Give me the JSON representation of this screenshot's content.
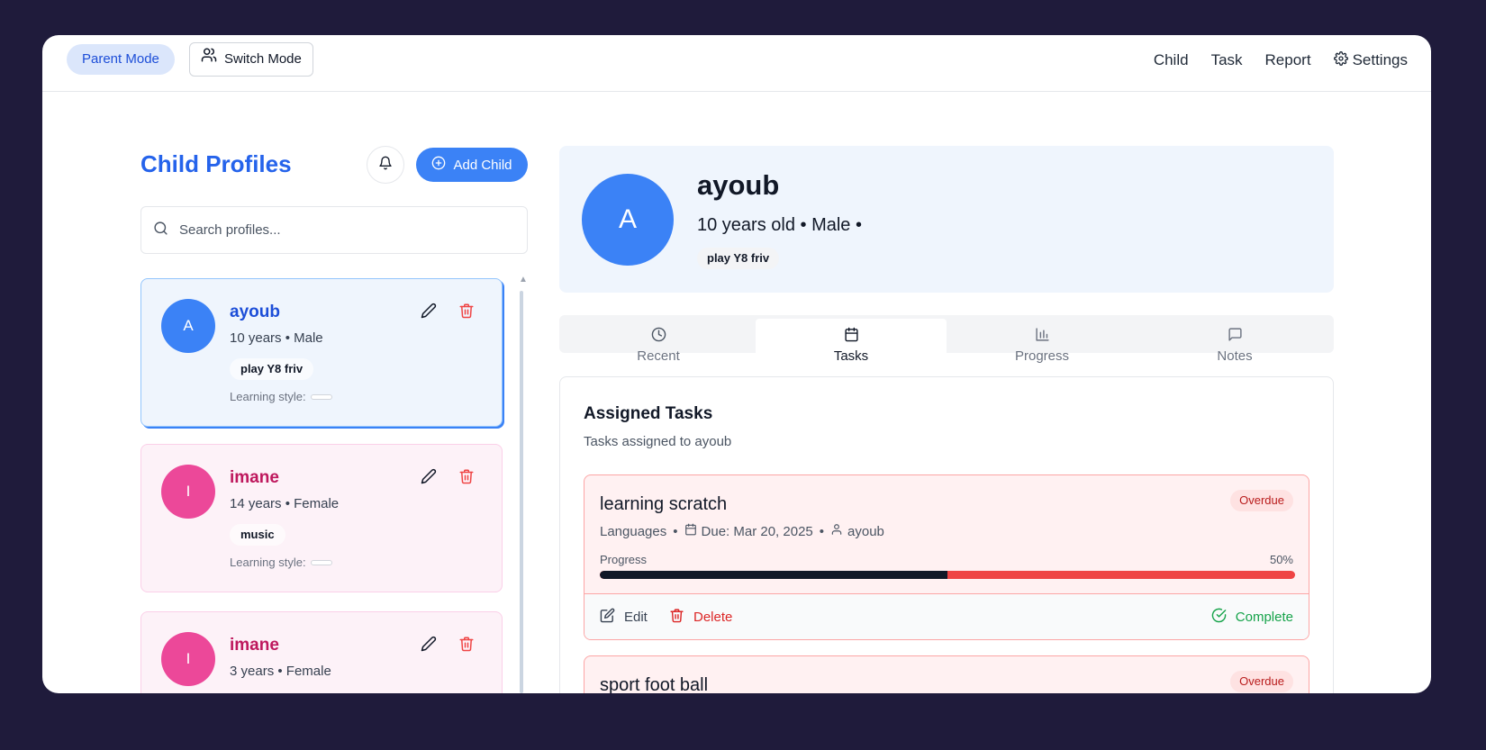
{
  "header": {
    "mode_label": "Parent Mode",
    "switch_label": "Switch Mode",
    "nav": [
      {
        "label": "Child"
      },
      {
        "label": "Task"
      },
      {
        "label": "Report"
      },
      {
        "label": "Settings"
      }
    ]
  },
  "sidebar": {
    "title": "Child Profiles",
    "add_label": "Add Child",
    "search_placeholder": "Search profiles...",
    "profiles": [
      {
        "initial": "A",
        "name": "ayoub",
        "meta": "10 years • Male",
        "tag": "play Y8 friv",
        "learning_style_label": "Learning style:",
        "theme": "blue",
        "selected": true
      },
      {
        "initial": "I",
        "name": "imane",
        "meta": "14 years • Female",
        "tag": "music",
        "learning_style_label": "Learning style:",
        "theme": "pink",
        "selected": false
      },
      {
        "initial": "I",
        "name": "imane",
        "meta": "3 years • Female",
        "tag": "",
        "learning_style_label": "",
        "theme": "pink",
        "selected": false
      }
    ]
  },
  "profile": {
    "initial": "A",
    "name": "ayoub",
    "meta": "10 years old  •  Male  •",
    "tag": "play Y8 friv"
  },
  "tabs": [
    {
      "label": "Recent",
      "icon": "clock-icon",
      "active": false
    },
    {
      "label": "Tasks",
      "icon": "calendar-icon",
      "active": true
    },
    {
      "label": "Progress",
      "icon": "bar-chart-icon",
      "active": false
    },
    {
      "label": "Notes",
      "icon": "message-icon",
      "active": false
    }
  ],
  "tasks_panel": {
    "title": "Assigned Tasks",
    "subtitle": "Tasks assigned to ayoub",
    "tasks": [
      {
        "title": "learning scratch",
        "status": "Overdue",
        "category": "Languages",
        "due": "Due: Mar 20, 2025",
        "assignee": "ayoub",
        "progress_label": "Progress",
        "progress_text": "50%",
        "progress": 0.5,
        "edit_label": "Edit",
        "delete_label": "Delete",
        "complete_label": "Complete"
      },
      {
        "title": "sport foot ball",
        "status": "Overdue"
      }
    ]
  },
  "colors": {
    "background": "#1f1b3b",
    "accent": "#3b82f6",
    "pink": "#ec4899",
    "danger": "#ef4444",
    "success": "#16a34a"
  }
}
